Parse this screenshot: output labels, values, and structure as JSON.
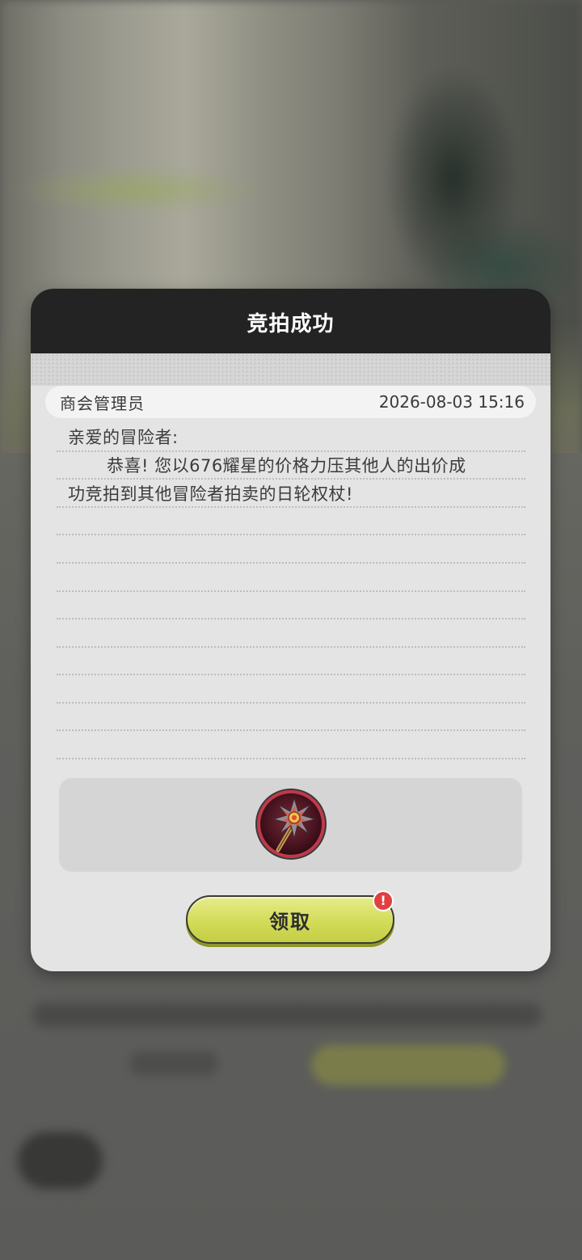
{
  "dialog": {
    "title": "竞拍成功",
    "sender": "商会管理员",
    "timestamp": "2026-08-03 15:16",
    "greeting": "亲爱的冒险者:",
    "body_line1": "恭喜! 您以676耀星的价格力压其他人的出价成",
    "body_line2": "功竞拍到其他冒险者拍卖的日轮权杖!",
    "reward_icon": "sun-scepter-icon",
    "claim_label": "领取",
    "alert_mark": "!"
  },
  "colors": {
    "header": "#232323",
    "dialog_bg": "#e4e4e4",
    "button": "#d3dc58",
    "alert": "#e04040",
    "reward_ring": "#c0394a"
  }
}
